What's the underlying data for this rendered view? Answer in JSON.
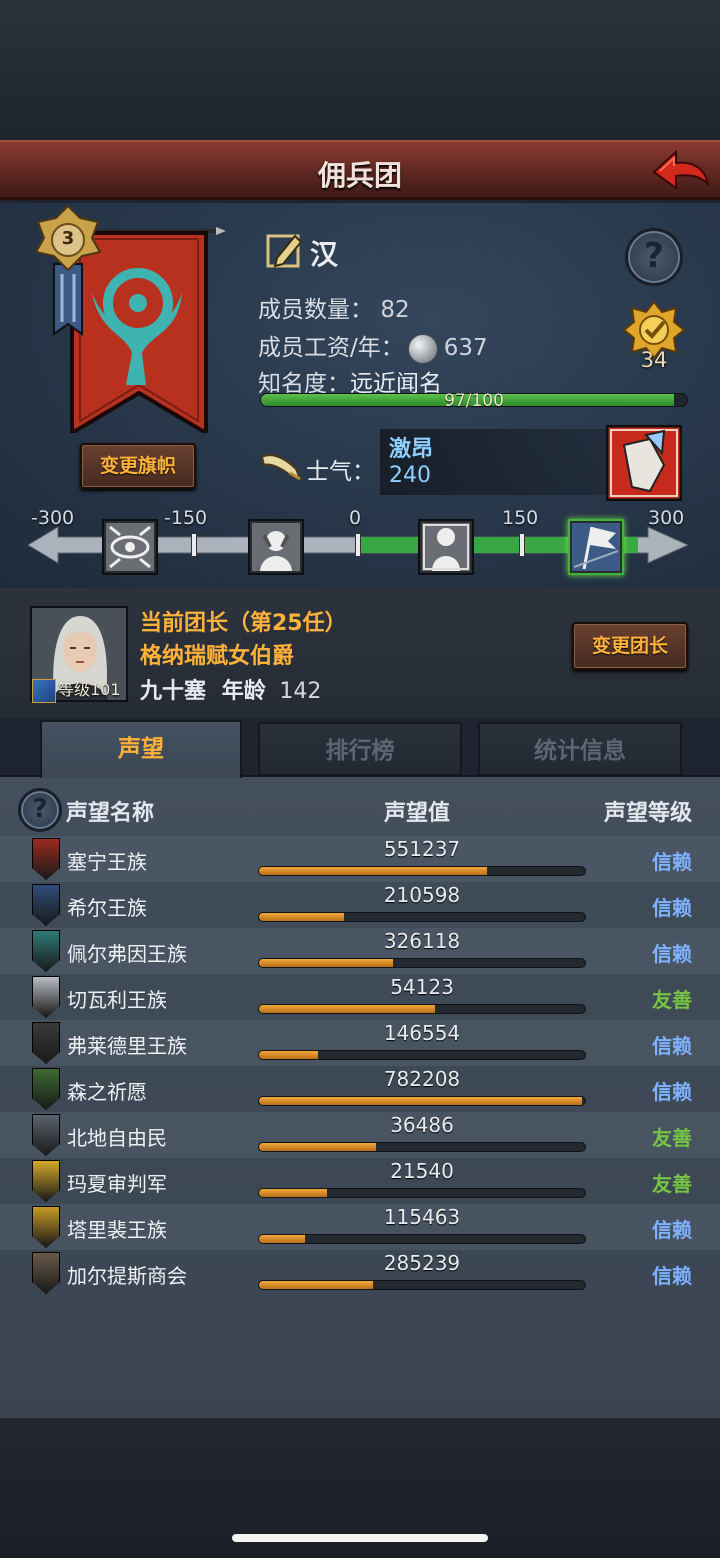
{
  "header": {
    "title": "佣兵团"
  },
  "company": {
    "banner_level": "3",
    "name": "汉",
    "members_label": "成员数量：",
    "members_value": "82",
    "wage_label": "成员工资/年：",
    "wage_value": "637",
    "fame_label": "知名度：",
    "fame_value": "远近闻名",
    "fame_progress_text": "97/100",
    "fame_progress": 0.97,
    "medal_count": "34",
    "change_flag_label": "变更旗帜"
  },
  "morale": {
    "label": "士气：",
    "state": "激昂",
    "value": "240",
    "scale_labels": [
      "-300",
      "-150",
      "0",
      "150",
      "300"
    ],
    "current": 240,
    "range": [
      -300,
      300
    ]
  },
  "leader": {
    "title": "当前团长（第25任）",
    "name": "格纳瑞赋女伯爵",
    "level_text": "等级101",
    "origin": "九十塞",
    "age_label": "年龄",
    "age": "142",
    "change_label": "变更团长"
  },
  "tabs": [
    {
      "label": "声望",
      "active": true
    },
    {
      "label": "排行榜",
      "active": false
    },
    {
      "label": "统计信息",
      "active": false
    }
  ],
  "reputation": {
    "col_name": "声望名称",
    "col_value": "声望值",
    "col_level": "声望等级",
    "rows": [
      {
        "name": "塞宁王族",
        "value": "551237",
        "fill": 0.7,
        "level": "信赖",
        "level_color": "#7fb2ff",
        "crest_color": "#9a2a1e"
      },
      {
        "name": "希尔王族",
        "value": "210598",
        "fill": 0.26,
        "level": "信赖",
        "level_color": "#7fb2ff",
        "crest_color": "#2f4e7a"
      },
      {
        "name": "佩尔弗因王族",
        "value": "326118",
        "fill": 0.41,
        "level": "信赖",
        "level_color": "#7fb2ff",
        "crest_color": "#2e7a78"
      },
      {
        "name": "切瓦利王族",
        "value": "54123",
        "fill": 0.54,
        "level": "友善",
        "level_color": "#76c445",
        "crest_color": "#b8bcc2"
      },
      {
        "name": "弗莱德里王族",
        "value": "146554",
        "fill": 0.18,
        "level": "信赖",
        "level_color": "#7fb2ff",
        "crest_color": "#3a3a3a"
      },
      {
        "name": "森之祈愿",
        "value": "782208",
        "fill": 0.99,
        "level": "信赖",
        "level_color": "#7fb2ff",
        "crest_color": "#3d6a30"
      },
      {
        "name": "北地自由民",
        "value": "36486",
        "fill": 0.36,
        "level": "友善",
        "level_color": "#76c445",
        "crest_color": "#5a6470"
      },
      {
        "name": "玛夏审判军",
        "value": "21540",
        "fill": 0.21,
        "level": "友善",
        "level_color": "#76c445",
        "crest_color": "#d4a92a"
      },
      {
        "name": "塔里裴王族",
        "value": "115463",
        "fill": 0.14,
        "level": "信赖",
        "level_color": "#7fb2ff",
        "crest_color": "#c89a26"
      },
      {
        "name": "加尔提斯商会",
        "value": "285239",
        "fill": 0.35,
        "level": "信赖",
        "level_color": "#7fb2ff",
        "crest_color": "#6a5a48"
      }
    ]
  }
}
